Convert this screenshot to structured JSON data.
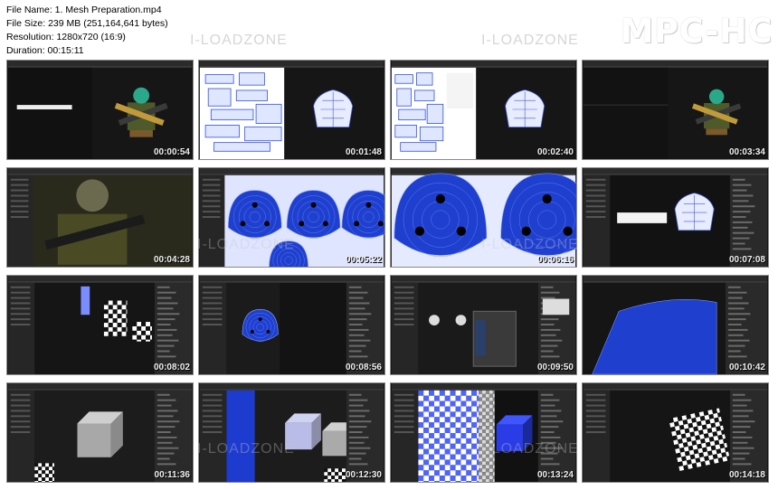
{
  "file_info": {
    "file_name": "File Name: 1. Mesh Preparation.mp4",
    "file_size": "File Size: 239 MB (251,164,641 bytes)",
    "resolution": "Resolution: 1280x720 (16:9)",
    "duration": "Duration: 00:15:11"
  },
  "logo": "MPC-HC",
  "watermark": "I-LOADZONE",
  "thumbnails": [
    {
      "time": "00:00:54",
      "scene": "character"
    },
    {
      "time": "00:01:48",
      "scene": "uv-layout"
    },
    {
      "time": "00:02:40",
      "scene": "uv-layout-2"
    },
    {
      "time": "00:03:34",
      "scene": "character-small"
    },
    {
      "time": "00:04:28",
      "scene": "character-close"
    },
    {
      "time": "00:05:22",
      "scene": "blue-shapes"
    },
    {
      "time": "00:06:16",
      "scene": "blue-zoom"
    },
    {
      "time": "00:07:08",
      "scene": "white-mesh"
    },
    {
      "time": "00:08:02",
      "scene": "checker-claws"
    },
    {
      "time": "00:08:56",
      "scene": "blue-small"
    },
    {
      "time": "00:09:50",
      "scene": "dialog"
    },
    {
      "time": "00:10:42",
      "scene": "blue-big"
    },
    {
      "time": "00:11:36",
      "scene": "cube"
    },
    {
      "time": "00:12:30",
      "scene": "cube-blue"
    },
    {
      "time": "00:13:24",
      "scene": "checker-cube"
    },
    {
      "time": "00:14:18",
      "scene": "checker-mesh"
    }
  ]
}
